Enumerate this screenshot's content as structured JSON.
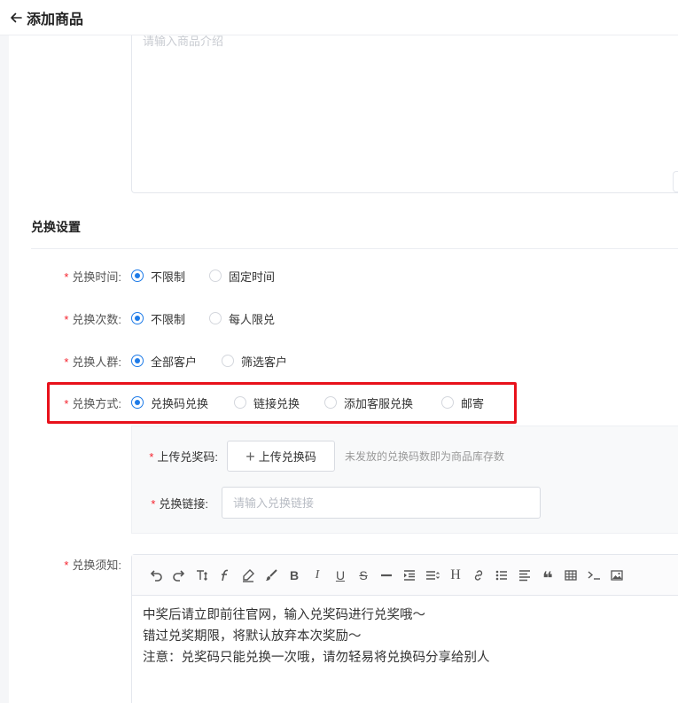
{
  "header": {
    "title": "添加商品",
    "back_icon": "arrow-left-icon"
  },
  "intro": {
    "placeholder": "请输入商品介绍"
  },
  "section": {
    "title": "兑换设置"
  },
  "exchange_time": {
    "label": "兑换时间:",
    "options": [
      "不限制",
      "固定时间"
    ],
    "selected": "不限制"
  },
  "exchange_count": {
    "label": "兑换次数:",
    "options": [
      "不限制",
      "每人限兑"
    ],
    "selected": "不限制"
  },
  "exchange_group": {
    "label": "兑换人群:",
    "options": [
      "全部客户",
      "筛选客户"
    ],
    "selected": "全部客户"
  },
  "exchange_method": {
    "label": "兑换方式:",
    "options": [
      "兑换码兑换",
      "链接兑换",
      "添加客服兑换",
      "邮寄"
    ],
    "selected": "兑换码兑换"
  },
  "upload": {
    "label": "上传兑奖码:",
    "button": "上传兑换码",
    "hint": "未发放的兑换码数即为商品库存数"
  },
  "link": {
    "label": "兑换链接:",
    "placeholder": "请输入兑换链接"
  },
  "notice": {
    "label": "兑换须知:",
    "lines": [
      "中奖后请立即前往官网，输入兑奖码进行兑奖哦～",
      "错过兑奖期限，将默认放弃本次奖励～",
      "注意：兑奖码只能兑换一次哦，请勿轻易将兑换码分享给别人"
    ]
  },
  "toolbar": {
    "tools": [
      "undo-icon",
      "redo-icon",
      "font-size-icon",
      "font-family-icon",
      "highlight-icon",
      "brush-icon",
      "bold-icon",
      "italic-icon",
      "underline-icon",
      "strikethrough-icon",
      "horizontal-rule-icon",
      "indent-icon",
      "line-height-icon",
      "heading-icon",
      "link-icon",
      "bullet-list-icon",
      "align-icon",
      "quote-icon",
      "table-icon",
      "code-icon",
      "image-icon"
    ]
  },
  "colors": {
    "accent": "#1e7be8",
    "required": "#f5222d",
    "highlight": "#e8111b"
  }
}
